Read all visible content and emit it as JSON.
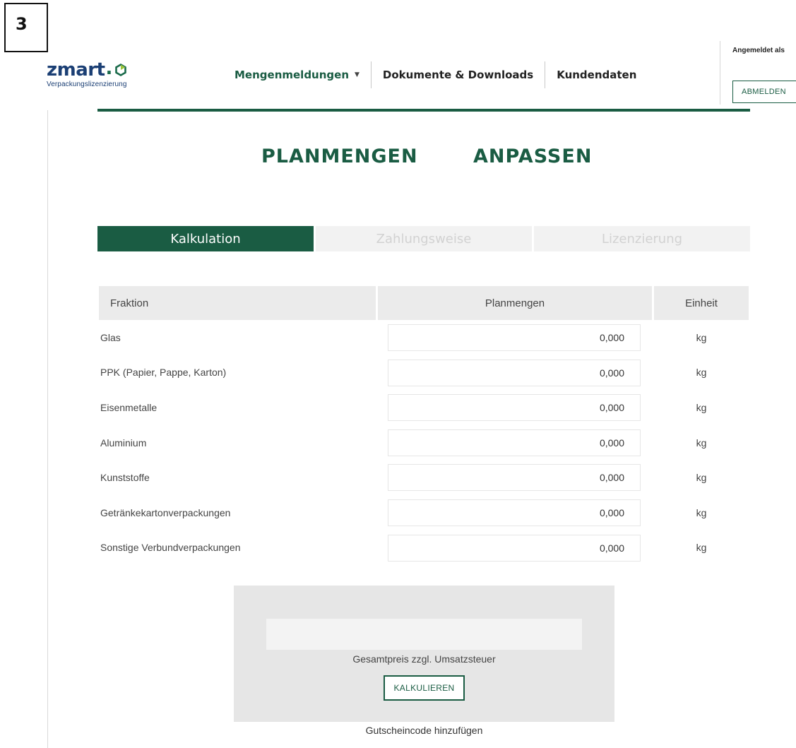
{
  "step_number": "3",
  "brand": {
    "name": "zmart",
    "dot": ".",
    "tagline": "Verpackungslizenzierung"
  },
  "nav": {
    "items": [
      {
        "label": "Mengenmeldungen",
        "has_dropdown": true
      },
      {
        "label": "Dokumente & Downloads"
      },
      {
        "label": "Kundendaten"
      }
    ]
  },
  "account": {
    "logged_in_label": "Angemeldet als",
    "logout_label": "ABMELDEN"
  },
  "page": {
    "title_left": "PLANMENGEN",
    "title_right": "ANPASSEN"
  },
  "steps": [
    {
      "label": "Kalkulation",
      "active": true
    },
    {
      "label": "Zahlungsweise",
      "active": false
    },
    {
      "label": "Lizenzierung",
      "active": false
    }
  ],
  "table": {
    "headers": [
      "Fraktion",
      "Planmengen",
      "Einheit"
    ],
    "rows": [
      {
        "fraction": "Glas",
        "amount": "0,000",
        "unit": "kg"
      },
      {
        "fraction": "PPK (Papier, Pappe, Karton)",
        "amount": "0,000",
        "unit": "kg"
      },
      {
        "fraction": "Eisenmetalle",
        "amount": "0,000",
        "unit": "kg"
      },
      {
        "fraction": "Aluminium",
        "amount": "0,000",
        "unit": "kg"
      },
      {
        "fraction": "Kunststoffe",
        "amount": "0,000",
        "unit": "kg"
      },
      {
        "fraction": "Getränkekartonverpackungen",
        "amount": "0,000",
        "unit": "kg"
      },
      {
        "fraction": "Sonstige Verbundverpackungen",
        "amount": "0,000",
        "unit": "kg"
      }
    ]
  },
  "calculation": {
    "total_price_value": "",
    "total_price_label": "Gesamtpreis zzgl. Umsatzsteuer",
    "calculate_button": "KALKULIEREN",
    "voucher_link": "Gutscheincode hinzufügen"
  },
  "colors": {
    "brand_green": "#1a5c43",
    "brand_blue": "#1b3f74",
    "header_gray": "#ebebeb",
    "panel_gray": "#e6e6e6"
  },
  "icons": {
    "logo_mark": "hexagon-icon",
    "nav_dropdown": "caret-down-icon"
  }
}
